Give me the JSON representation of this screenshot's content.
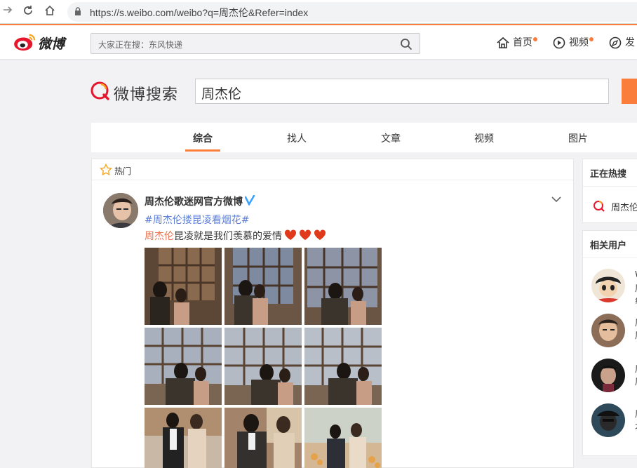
{
  "browser": {
    "url": "https://s.weibo.com/weibo?q=周杰伦&Refer=index",
    "back_icon": "→",
    "reload_icon": "↻",
    "home_icon": "⌂"
  },
  "header": {
    "logo_text": "微博",
    "search_placeholder": "大家正在搜：东风快递",
    "nav": [
      {
        "label": "首页",
        "icon": "home-icon"
      },
      {
        "label": "视频",
        "icon": "video-icon"
      },
      {
        "label": "发",
        "icon": "compass-icon"
      }
    ],
    "accent_color": "#fa7d3c"
  },
  "search": {
    "title": "微博搜索",
    "query": "周杰伦"
  },
  "tabs": [
    {
      "label": "综合",
      "active": true
    },
    {
      "label": "找人",
      "active": false
    },
    {
      "label": "文章",
      "active": false
    },
    {
      "label": "视频",
      "active": false
    },
    {
      "label": "图片",
      "active": false
    }
  ],
  "feed": {
    "section_label": "热门",
    "post": {
      "user": "周杰伦歌迷网官方微博",
      "topic": "#周杰伦搂昆凌看烟花#",
      "mention": "周杰伦",
      "text": "昆凌就是我们羡慕的爱情",
      "photo_count": 9
    }
  },
  "sidebar": {
    "hot_title": "正在热搜",
    "hot_item": "周杰伦",
    "related_title": "相关用户",
    "users": [
      {
        "frag1": "W",
        "frag2": "周",
        "frag3": "纟"
      },
      {
        "frag1": "周",
        "frag2": "周"
      },
      {
        "frag1": "周",
        "frag2": "周"
      },
      {
        "frag1": "周",
        "frag2": "才"
      }
    ]
  }
}
